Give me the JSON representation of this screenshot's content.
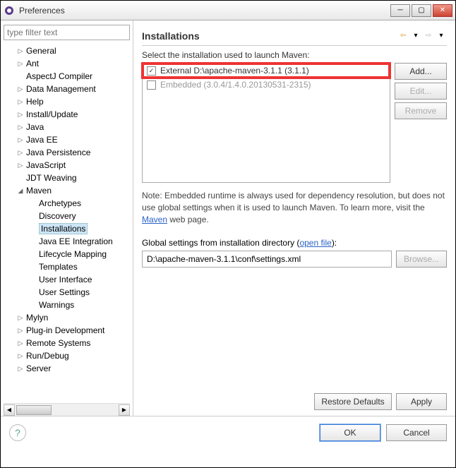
{
  "window": {
    "title": "Preferences"
  },
  "filter_placeholder": "type filter text",
  "tree": [
    {
      "label": "General",
      "exp": "▷",
      "indent": 1
    },
    {
      "label": "Ant",
      "exp": "▷",
      "indent": 1
    },
    {
      "label": "AspectJ Compiler",
      "exp": "",
      "indent": 1
    },
    {
      "label": "Data Management",
      "exp": "▷",
      "indent": 1
    },
    {
      "label": "Help",
      "exp": "▷",
      "indent": 1
    },
    {
      "label": "Install/Update",
      "exp": "▷",
      "indent": 1
    },
    {
      "label": "Java",
      "exp": "▷",
      "indent": 1
    },
    {
      "label": "Java EE",
      "exp": "▷",
      "indent": 1
    },
    {
      "label": "Java Persistence",
      "exp": "▷",
      "indent": 1
    },
    {
      "label": "JavaScript",
      "exp": "▷",
      "indent": 1
    },
    {
      "label": "JDT Weaving",
      "exp": "",
      "indent": 1
    },
    {
      "label": "Maven",
      "exp": "▢",
      "indent": 1
    },
    {
      "label": "Archetypes",
      "exp": "",
      "indent": 2
    },
    {
      "label": "Discovery",
      "exp": "",
      "indent": 2
    },
    {
      "label": "Installations",
      "exp": "",
      "indent": 2,
      "selected": true
    },
    {
      "label": "Java EE Integration",
      "exp": "",
      "indent": 2
    },
    {
      "label": "Lifecycle Mapping",
      "exp": "",
      "indent": 2
    },
    {
      "label": "Templates",
      "exp": "",
      "indent": 2
    },
    {
      "label": "User Interface",
      "exp": "",
      "indent": 2
    },
    {
      "label": "User Settings",
      "exp": "",
      "indent": 2
    },
    {
      "label": "Warnings",
      "exp": "",
      "indent": 2
    },
    {
      "label": "Mylyn",
      "exp": "▷",
      "indent": 1
    },
    {
      "label": "Plug-in Development",
      "exp": "▷",
      "indent": 1
    },
    {
      "label": "Remote Systems",
      "exp": "▷",
      "indent": 1
    },
    {
      "label": "Run/Debug",
      "exp": "▷",
      "indent": 1
    },
    {
      "label": "Server",
      "exp": "▷",
      "indent": 1
    }
  ],
  "page": {
    "title": "Installations",
    "select_label": "Select the installation used to launch Maven:",
    "rows": [
      {
        "checked": true,
        "text": "External D:\\apache-maven-3.1.1 (3.1.1)",
        "highlight": true
      },
      {
        "checked": false,
        "text": "Embedded (3.0.4/1.4.0.20130531-2315)",
        "disabled": true
      }
    ],
    "buttons": {
      "add": "Add...",
      "edit": "Edit...",
      "remove": "Remove"
    },
    "note_prefix": "Note: Embedded runtime is always used for dependency resolution, but does not use global settings when it is used to launch Maven. To learn more, visit the ",
    "note_link": "Maven",
    "note_suffix": " web page.",
    "gs_label_prefix": "Global settings from installation directory (",
    "gs_open": "open file",
    "gs_label_suffix": "):",
    "gs_value": "D:\\apache-maven-3.1.1\\conf\\settings.xml",
    "browse": "Browse...",
    "restore": "Restore Defaults",
    "apply": "Apply"
  },
  "footer": {
    "ok": "OK",
    "cancel": "Cancel"
  }
}
